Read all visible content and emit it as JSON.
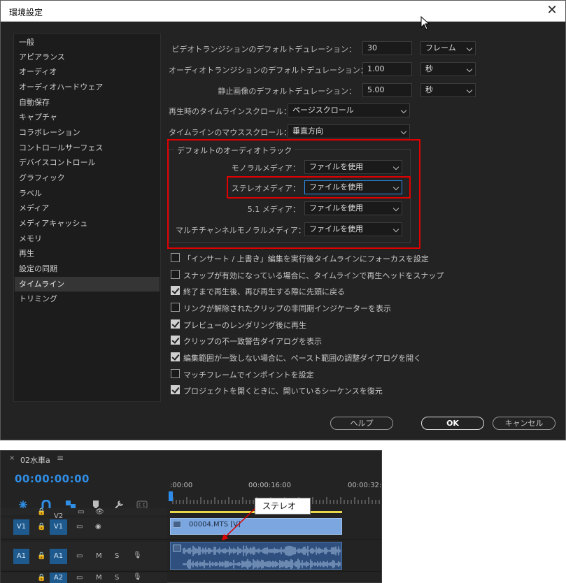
{
  "dialog": {
    "title": "環境設定",
    "close_symbol": "✕",
    "sidebar": {
      "items": [
        {
          "label": "一般",
          "active": false
        },
        {
          "label": "アピアランス",
          "active": false
        },
        {
          "label": "オーディオ",
          "active": false
        },
        {
          "label": "オーディオハードウェア",
          "active": false
        },
        {
          "label": "自動保存",
          "active": false
        },
        {
          "label": "キャプチャ",
          "active": false
        },
        {
          "label": "コラボレーション",
          "active": false
        },
        {
          "label": "コントロールサーフェス",
          "active": false
        },
        {
          "label": "デバイスコントロール",
          "active": false
        },
        {
          "label": "グラフィック",
          "active": false
        },
        {
          "label": "ラベル",
          "active": false
        },
        {
          "label": "メディア",
          "active": false
        },
        {
          "label": "メディアキャッシュ",
          "active": false
        },
        {
          "label": "メモリ",
          "active": false
        },
        {
          "label": "再生",
          "active": false
        },
        {
          "label": "設定の同期",
          "active": false
        },
        {
          "label": "タイムライン",
          "active": true
        },
        {
          "label": "トリミング",
          "active": false
        }
      ]
    },
    "durations": [
      {
        "label": "ビデオトランジションのデフォルトデュレーション：",
        "value": "30",
        "unit": "フレーム"
      },
      {
        "label": "オーディオトランジションのデフォルトデュレーション：",
        "value": "1.00",
        "unit": "秒"
      },
      {
        "label": "静止画像のデフォルトデュレーション：",
        "value": "5.00",
        "unit": "秒"
      }
    ],
    "scroll_playback": {
      "label": "再生時のタイムラインスクロール：",
      "value": "ページスクロール"
    },
    "scroll_mouse": {
      "label": "タイムラインのマウススクロール：",
      "value": "垂直方向"
    },
    "audio_group": {
      "title": "デフォルトのオーディオトラック",
      "rows": [
        {
          "label": "モノラルメディア：",
          "value": "ファイルを使用"
        },
        {
          "label": "ステレオメディア：",
          "value": "ファイルを使用"
        },
        {
          "label": "5.1 メディア：",
          "value": "ファイルを使用"
        },
        {
          "label": "マルチチャンネルモノラルメディア：",
          "value": "ファイルを使用"
        }
      ]
    },
    "checkboxes": [
      {
        "label": "「インサート / 上書き」編集を実行後タイムラインにフォーカスを設定",
        "checked": false
      },
      {
        "label": "スナップが有効になっている場合に、タイムラインで再生ヘッドをスナップ",
        "checked": false
      },
      {
        "label": "終了まで再生後、再び再生する際に先頭に戻る",
        "checked": true
      },
      {
        "label": "リンクが解除されたクリップの非同期インジケーターを表示",
        "checked": false
      },
      {
        "label": "プレビューのレンダリング後に再生",
        "checked": true
      },
      {
        "label": "クリップの不一致警告ダイアログを表示",
        "checked": true
      },
      {
        "label": "編集範囲が一致しない場合に、ペースト範囲の調整ダイアログを開く",
        "checked": true
      },
      {
        "label": "マッチフレームでインポイントを設定",
        "checked": false
      },
      {
        "label": "プロジェクトを開くときに、開いているシーケンスを復元",
        "checked": true
      }
    ],
    "buttons": {
      "help": "ヘルプ",
      "ok": "OK",
      "cancel": "キャンセル"
    }
  },
  "timeline": {
    "close_symbol": "×",
    "sequence_name": "02水車a",
    "menu_symbol": "≡",
    "timecode": "00:00:00:00",
    "ruler": [
      ":00:00",
      "00:00:16:00",
      "00:00:32:"
    ],
    "tracks": {
      "v2": {
        "label": "V2"
      },
      "v1": {
        "source": "V1",
        "label": "V1",
        "mute_glyph": "◉"
      },
      "a1": {
        "source": "A1",
        "label": "A1",
        "m": "M",
        "s": "S"
      },
      "a2": {
        "label": "A2",
        "m": "M",
        "s": "S"
      }
    },
    "clip_name": "00004.MTS [V]",
    "callout": "ステレオ"
  },
  "colors": {
    "accent_blue": "#2d8ceb",
    "highlight_red": "#e00000",
    "video_clip": "#7ba6e0",
    "audio_clip": "#2f4f7e",
    "work_area": "#e8d84a"
  }
}
